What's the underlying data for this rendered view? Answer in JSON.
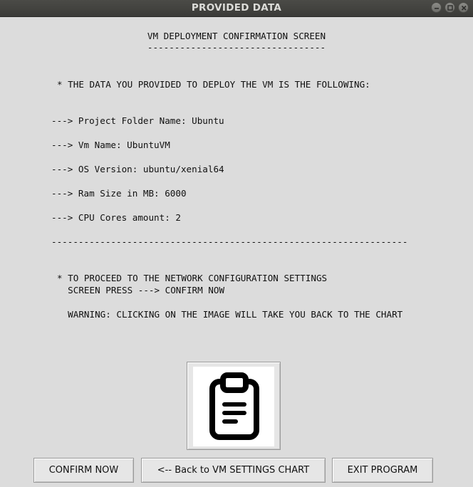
{
  "window": {
    "title": "PROVIDED DATA",
    "controls": [
      "minimize-icon",
      "maximize-icon",
      "close-icon"
    ]
  },
  "header": {
    "title": "VM DEPLOYMENT CONFIRMATION SCREEN",
    "underline": "---------------------------------"
  },
  "intro": "* THE DATA YOU PROVIDED TO DEPLOY THE VM IS THE FOLLOWING:",
  "details": [
    "---> Project Folder Name: Ubuntu",
    "---> Vm Name: UbuntuVM",
    "---> OS Version: ubuntu/xenial64",
    "---> Ram Size in MB: 6000",
    "---> CPU Cores amount: 2"
  ],
  "separator": "------------------------------------------------------------------",
  "instructions": {
    "line1": "* TO PROCEED TO THE NETWORK CONFIGURATION SETTINGS",
    "line2": "  SCREEN PRESS ---> CONFIRM NOW",
    "warning": "  WARNING: CLICKING ON THE IMAGE WILL TAKE YOU BACK TO THE CHART"
  },
  "image_button": {
    "icon": "clipboard-icon"
  },
  "buttons": {
    "confirm": "CONFIRM NOW",
    "back": "<-- Back to VM SETTINGS CHART",
    "exit": "EXIT PROGRAM"
  }
}
